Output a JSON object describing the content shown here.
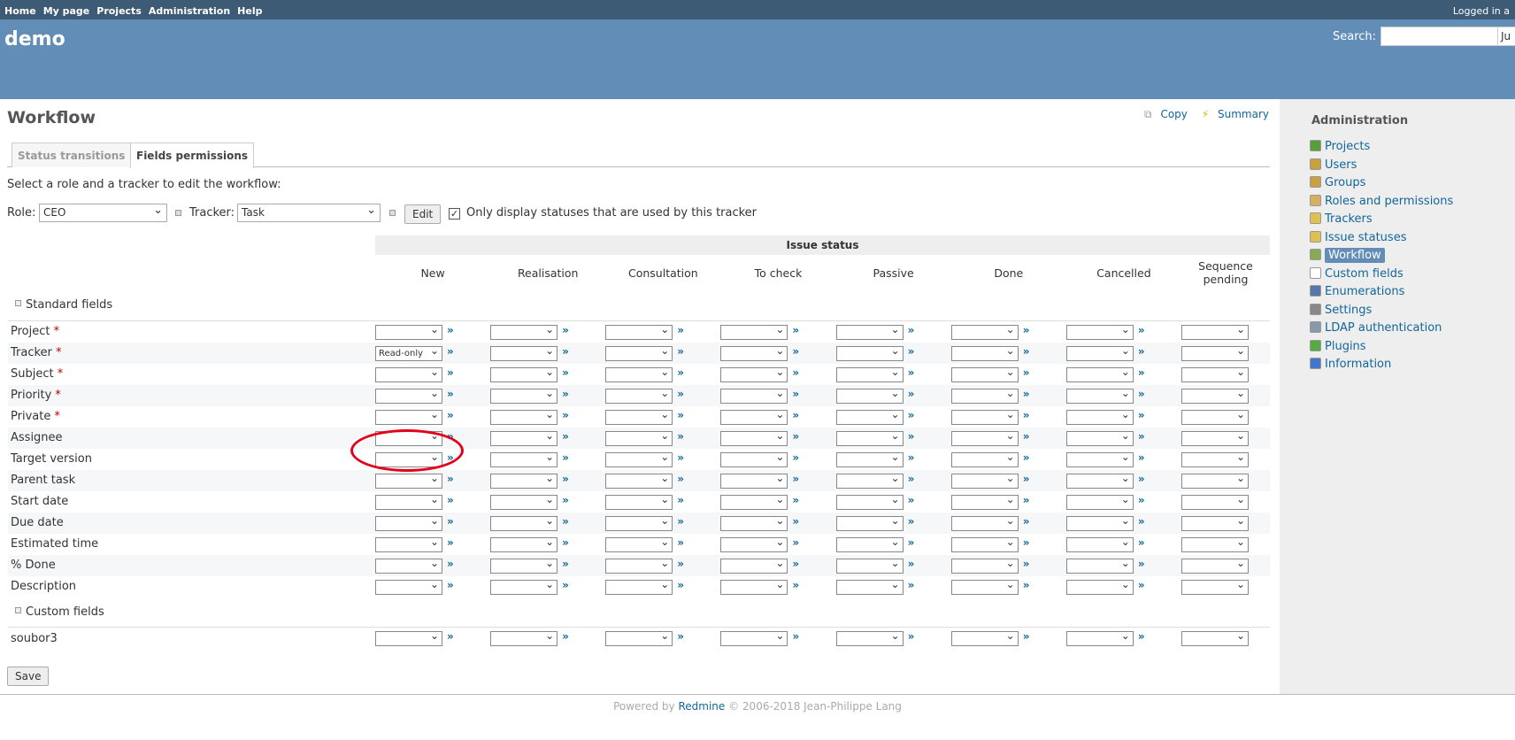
{
  "top_menu": {
    "items": [
      "Home",
      "My page",
      "Projects",
      "Administration",
      "Help"
    ],
    "logged_in": "Logged in a"
  },
  "header": {
    "title": "demo",
    "search_label": "Search:",
    "jump_value": "Ju"
  },
  "page": {
    "title": "Workflow",
    "actions": {
      "copy": "Copy",
      "summary": "Summary"
    },
    "tabs": [
      "Status transitions",
      "Fields permissions"
    ],
    "instruction": "Select a role and a tracker to edit the workflow:",
    "role_label": "Role:",
    "role_value": "CEO",
    "tracker_label": "Tracker:",
    "tracker_value": "Task",
    "edit_button": "Edit",
    "only_used_label": "Only display statuses that are used by this tracker",
    "only_used_checked": true,
    "save_button": "Save"
  },
  "table": {
    "group_header": "Issue status",
    "statuses": [
      "New",
      "Realisation",
      "Consultation",
      "To check",
      "Passive",
      "Done",
      "Cancelled",
      "Sequence pending"
    ],
    "standard_section": "Standard fields",
    "custom_section": "Custom fields",
    "standard_fields": [
      {
        "name": "Project",
        "required": true
      },
      {
        "name": "Tracker",
        "required": true
      },
      {
        "name": "Subject",
        "required": true
      },
      {
        "name": "Priority",
        "required": true
      },
      {
        "name": "Private",
        "required": true
      },
      {
        "name": "Assignee",
        "required": false
      },
      {
        "name": "Target version",
        "required": false
      },
      {
        "name": "Parent task",
        "required": false
      },
      {
        "name": "Start date",
        "required": false
      },
      {
        "name": "Due date",
        "required": false
      },
      {
        "name": "Estimated time",
        "required": false
      },
      {
        "name": "% Done",
        "required": false
      },
      {
        "name": "Description",
        "required": false
      }
    ],
    "custom_fields": [
      {
        "name": "soubor3",
        "required": false
      }
    ],
    "required_marker": "*",
    "arrow_glyph": "»",
    "highlighted_cell": {
      "field": "Tracker",
      "status": "New",
      "value": "Read-only"
    }
  },
  "sidebar": {
    "title": "Administration",
    "items": [
      {
        "label": "Projects",
        "icon": "projects-icon",
        "color": "#5a9e3a"
      },
      {
        "label": "Users",
        "icon": "user-icon",
        "color": "#c8a040"
      },
      {
        "label": "Groups",
        "icon": "group-icon",
        "color": "#c8a040"
      },
      {
        "label": "Roles and permissions",
        "icon": "key-icon",
        "color": "#d4b060"
      },
      {
        "label": "Trackers",
        "icon": "ticket-icon",
        "color": "#e0c050"
      },
      {
        "label": "Issue statuses",
        "icon": "tag-icon",
        "color": "#e0c050"
      },
      {
        "label": "Workflow",
        "icon": "workflow-icon",
        "color": "#88aa55"
      },
      {
        "label": "Custom fields",
        "icon": "textfield-icon",
        "color": "#ffffff"
      },
      {
        "label": "Enumerations",
        "icon": "list-icon",
        "color": "#5577aa"
      },
      {
        "label": "Settings",
        "icon": "gear-icon",
        "color": "#888888"
      },
      {
        "label": "LDAP authentication",
        "icon": "server-icon",
        "color": "#8899aa"
      },
      {
        "label": "Plugins",
        "icon": "plugin-icon",
        "color": "#55aa44"
      },
      {
        "label": "Information",
        "icon": "info-icon",
        "color": "#4477cc"
      }
    ],
    "selected": "Workflow"
  },
  "footer": {
    "prefix": "Powered by",
    "link": "Redmine",
    "suffix": "© 2006-2018 Jean-Philippe Lang"
  },
  "colors": {
    "top_menu": "#3e5b76",
    "header": "#628db6",
    "link": "#116699",
    "required": "#bb0000",
    "highlight_circle": "#e2001a"
  }
}
